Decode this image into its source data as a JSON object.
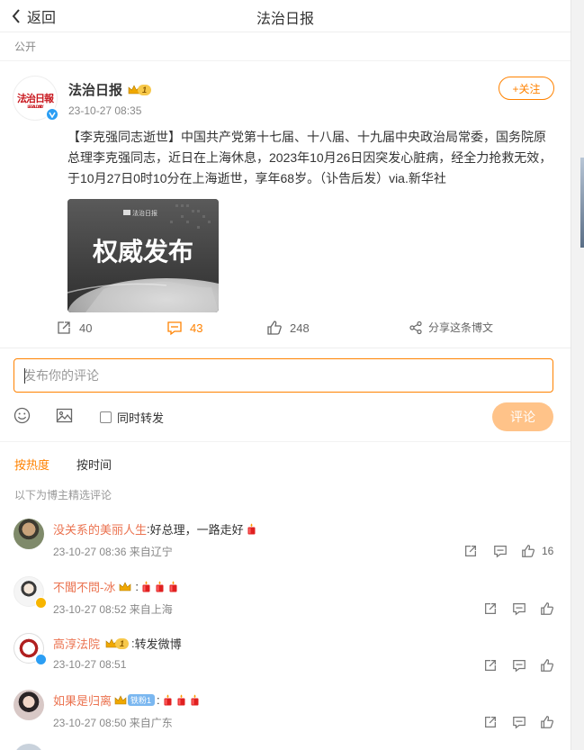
{
  "header": {
    "back_label": "返回",
    "title": "法治日报"
  },
  "visibility": "公开",
  "post": {
    "author": "法治日报",
    "avatar_logo": "法治日报",
    "level": "1",
    "time": "23-10-27 08:35",
    "follow_label": "+关注",
    "text": "【李克强同志逝世】中国共产党第十七届、十八届、十九届中央政治局常委，国务院原总理李克强同志，近日在上海休息，2023年10月26日因突发心脏病，经全力抢救无效，于10月27日0时10分在上海逝世，享年68岁。（讣告后发）via.新华社",
    "image_headline": "权威发布",
    "image_brand": "法治日报",
    "reposts": "40",
    "comments": "43",
    "likes": "248",
    "share_label": "分享这条博文"
  },
  "composer": {
    "placeholder": "发布你的评论",
    "sync_label": "同时转发",
    "submit_label": "评论"
  },
  "sort": {
    "tabs": [
      "按热度",
      "按时间"
    ],
    "active": 0
  },
  "curated_label": "以下为博主精选评论",
  "comments": [
    {
      "name": "没关系的美丽人生",
      "sep": ":",
      "text": "好总理，一路走好",
      "emojis": [
        "candle"
      ],
      "time": "23-10-27 08:36",
      "location": "来自辽宁",
      "likes": "16"
    },
    {
      "name": "不聞不問-冰",
      "sep": ":",
      "text": "",
      "emojis": [
        "candle",
        "candle",
        "candle"
      ],
      "time": "23-10-27 08:52",
      "location": "来自上海",
      "likes": ""
    },
    {
      "name": "高淳法院",
      "sep": ":",
      "text": "转发微博",
      "level": "1",
      "time": "23-10-27 08:51",
      "location": "",
      "likes": ""
    },
    {
      "name": "如果是归离",
      "sep": ":",
      "text": "",
      "fan_badge": "铁粉1",
      "emojis": [
        "candle",
        "candle",
        "candle"
      ],
      "time": "23-10-27 08:50",
      "location": "来自广东",
      "likes": ""
    }
  ],
  "colors": {
    "accent": "#ff8200",
    "name": "#eb7350",
    "verified_blue": "#2b9ef4",
    "verified_gold": "#f7b500"
  },
  "icons": [
    "chevron-left-icon",
    "repost-icon",
    "comment-icon",
    "like-icon",
    "share-icon",
    "emoji-icon",
    "image-icon"
  ]
}
